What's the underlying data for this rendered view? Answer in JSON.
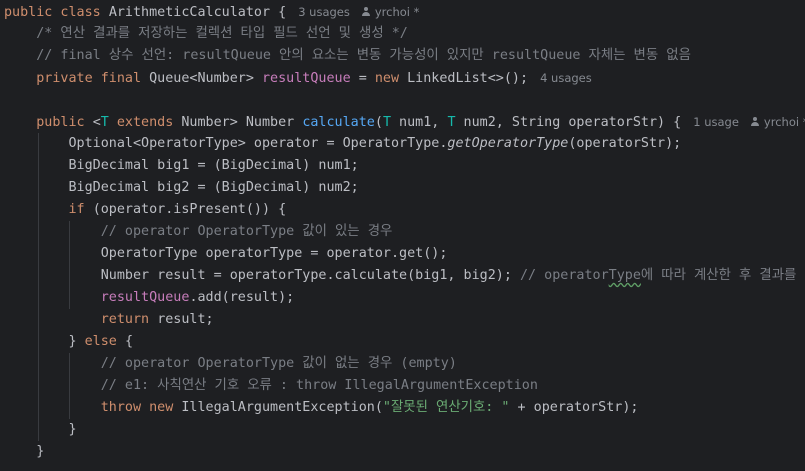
{
  "colors": {
    "background": "#1e1f22",
    "keyword": "#cf8e6d",
    "default": "#bcbec4",
    "comment": "#7a7e85",
    "method": "#56a8f5",
    "field": "#c77dbb",
    "string": "#6aab73",
    "type_param": "#16baac",
    "hint": "#868a91"
  },
  "lines": [
    [
      {
        "t": "public class ",
        "k": "keyword"
      },
      {
        "t": "ArithmeticCalculator {",
        "k": "default"
      },
      {
        "t": "3 usages",
        "k": "hint"
      },
      {
        "t": "yrchoi *",
        "k": "hint-author"
      }
    ],
    [
      {
        "t": "    /* 연산 결과를 저장하는 컬렉션 타입 필드 선언 및 생성 */",
        "k": "comment"
      }
    ],
    [
      {
        "t": "    // final 상수 선언: resultQueue 안의 요소는 변동 가능성이 있지만 resultQueue 자체는 변동 없음",
        "k": "comment"
      }
    ],
    [
      {
        "t": "    private final ",
        "k": "keyword"
      },
      {
        "t": "Queue<Number> ",
        "k": "default"
      },
      {
        "t": "resultQueue",
        "k": "field"
      },
      {
        "t": " = ",
        "k": "default"
      },
      {
        "t": "new ",
        "k": "keyword"
      },
      {
        "t": "LinkedList<>();",
        "k": "default"
      },
      {
        "t": "4 usages",
        "k": "hint"
      }
    ],
    [],
    [
      {
        "t": "    public ",
        "k": "keyword"
      },
      {
        "t": "<",
        "k": "default"
      },
      {
        "t": "T",
        "k": "type_param"
      },
      {
        "t": " extends ",
        "k": "keyword"
      },
      {
        "t": "Number> Number ",
        "k": "default"
      },
      {
        "t": "calculate",
        "k": "method"
      },
      {
        "t": "(",
        "k": "default"
      },
      {
        "t": "T",
        "k": "type_param"
      },
      {
        "t": " num1, ",
        "k": "default"
      },
      {
        "t": "T",
        "k": "type_param"
      },
      {
        "t": " num2, String operatorStr) {",
        "k": "default"
      },
      {
        "t": "1 usage",
        "k": "hint"
      },
      {
        "t": "yrchoi *",
        "k": "hint-author"
      }
    ],
    [
      {
        "t": "        Optional<OperatorType> operator = OperatorType.",
        "k": "default"
      },
      {
        "t": "getOperatorType",
        "k": "italic"
      },
      {
        "t": "(operatorStr);",
        "k": "default"
      }
    ],
    [
      {
        "t": "        BigDecimal big1 = (BigDecimal) num1;",
        "k": "default"
      }
    ],
    [
      {
        "t": "        BigDecimal big2 = (BigDecimal) num2;",
        "k": "default"
      }
    ],
    [
      {
        "t": "        if ",
        "k": "keyword"
      },
      {
        "t": "(operator.isPresent()) {",
        "k": "default"
      }
    ],
    [
      {
        "t": "            // operator OperatorType 값이 있는 경우",
        "k": "comment"
      }
    ],
    [
      {
        "t": "            OperatorType operatorType = operator.get();",
        "k": "default"
      }
    ],
    [
      {
        "t": "            Number result = operatorType.calculate(big1, big2); ",
        "k": "default"
      },
      {
        "t": "// operator",
        "k": "comment"
      },
      {
        "t": "Type",
        "k": "comment-squiggle"
      },
      {
        "t": "에 따라 계산한 후 결과를 반환",
        "k": "comment"
      }
    ],
    [
      {
        "t": "            ",
        "k": "default"
      },
      {
        "t": "resultQueue",
        "k": "field"
      },
      {
        "t": ".add(result);",
        "k": "default"
      }
    ],
    [
      {
        "t": "            return ",
        "k": "keyword"
      },
      {
        "t": "result;",
        "k": "default"
      }
    ],
    [
      {
        "t": "        } ",
        "k": "default"
      },
      {
        "t": "else ",
        "k": "keyword"
      },
      {
        "t": "{",
        "k": "default"
      }
    ],
    [
      {
        "t": "            // operator OperatorType 값이 없는 경우 (empty)",
        "k": "comment"
      }
    ],
    [
      {
        "t": "            // e1: 사칙연산 기호 오류 : throw IllegalArgumentException",
        "k": "comment"
      }
    ],
    [
      {
        "t": "            throw new ",
        "k": "keyword"
      },
      {
        "t": "IllegalArgumentException(",
        "k": "default"
      },
      {
        "t": "\"잘못된 연산기호: \"",
        "k": "string"
      },
      {
        "t": " + operatorStr);",
        "k": "default"
      }
    ],
    [
      {
        "t": "        }",
        "k": "default"
      }
    ],
    [
      {
        "t": "    }",
        "k": "default"
      }
    ]
  ]
}
